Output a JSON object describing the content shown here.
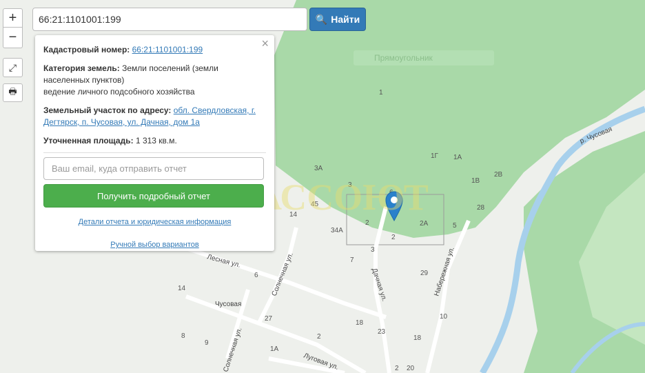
{
  "controls": {
    "zoom_in": "+",
    "zoom_out": "−",
    "fullscreen": "⤢",
    "print": "🖶"
  },
  "search": {
    "value": "66:21:1101001:199",
    "button_label": "Найти"
  },
  "popup": {
    "close": "×",
    "cadastral_label": "Кадастровый номер:",
    "cadastral_value": "66:21:1101001:199",
    "category_label": "Категория земель:",
    "category_value": "Земли поселений (земли населенных пунктов)",
    "category_use": "ведение личного подсобного хозяйства",
    "address_label": "Земельный участок по адресу:",
    "address_value": "обл. Свердловская, г. Дегтярск, п. Чусовая, ул. Дачная, дом 1а",
    "area_label": "Уточненная площадь:",
    "area_value": "1 313 кв.м.",
    "email_placeholder": "Ваш email, куда отправить отчет",
    "report_button": "Получить подробный отчет",
    "details_link": "Детали отчета и юридическая информация",
    "manual_link": "Ручной выбор вариантов"
  },
  "map": {
    "rect_tool_label": "Прямоугольник",
    "watermark": "АССОЮТ",
    "village": "Чусовая",
    "river": "р. Чусовая",
    "streets": [
      "Лесная ул.",
      "Солнечная ул.",
      "Дачная ул.",
      "Набережная ул.",
      "Луговая ул.",
      "Солнечная ул."
    ],
    "house_numbers": [
      "1",
      "1Г",
      "1А",
      "2В",
      "3А",
      "3",
      "6",
      "1В",
      "28",
      "45",
      "14",
      "34А",
      "2",
      "2А",
      "5",
      "3",
      "7",
      "2",
      "29",
      "6",
      "14",
      "27",
      "18",
      "10",
      "8",
      "23",
      "18",
      "9",
      "2",
      "1А",
      "20",
      "2"
    ],
    "colors": {
      "forest": "#a9d9a8",
      "water": "#a7d0ec",
      "land": "#eef0ec",
      "marker": "#2a81cb"
    }
  }
}
